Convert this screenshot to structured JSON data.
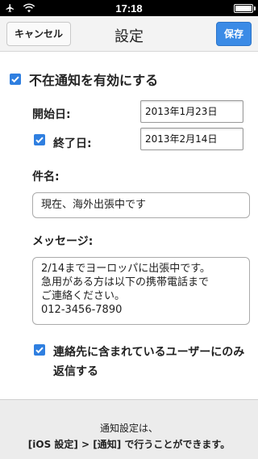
{
  "status_bar": {
    "time": "17:18",
    "battery_level": 1.0
  },
  "nav": {
    "title": "設定",
    "cancel_label": "キャンセル",
    "save_label": "保存",
    "save_color": "#3b8be6"
  },
  "form": {
    "enable_label": "不在通知を有効にする",
    "enable_checked": true,
    "start_date_label": "開始日:",
    "start_date_value": "2013年1月23日",
    "end_date_checked": true,
    "end_date_label": "終了日:",
    "end_date_value": "2013年2月14日",
    "subject_label": "件名:",
    "subject_value": "現在、海外出張中です",
    "message_label": "メッセージ:",
    "message_value": "2/14までヨーロッパに出張中です。\n急用がある方は以下の携帯電話まで\nご連絡ください。\n012-3456-7890",
    "reply_contacts_checked": true,
    "reply_contacts_label": "連絡先に含まれているユーザーにのみ返信する",
    "checkbox_color": "#2f7fe0"
  },
  "footer": {
    "line1": "通知設定は、",
    "line2": "[iOS 設定] > [通知] で行うことができます。"
  },
  "icons": {
    "airplane": "airplane-icon",
    "wifi": "wifi-icon",
    "battery": "battery-icon",
    "check": "checkmark-icon"
  }
}
